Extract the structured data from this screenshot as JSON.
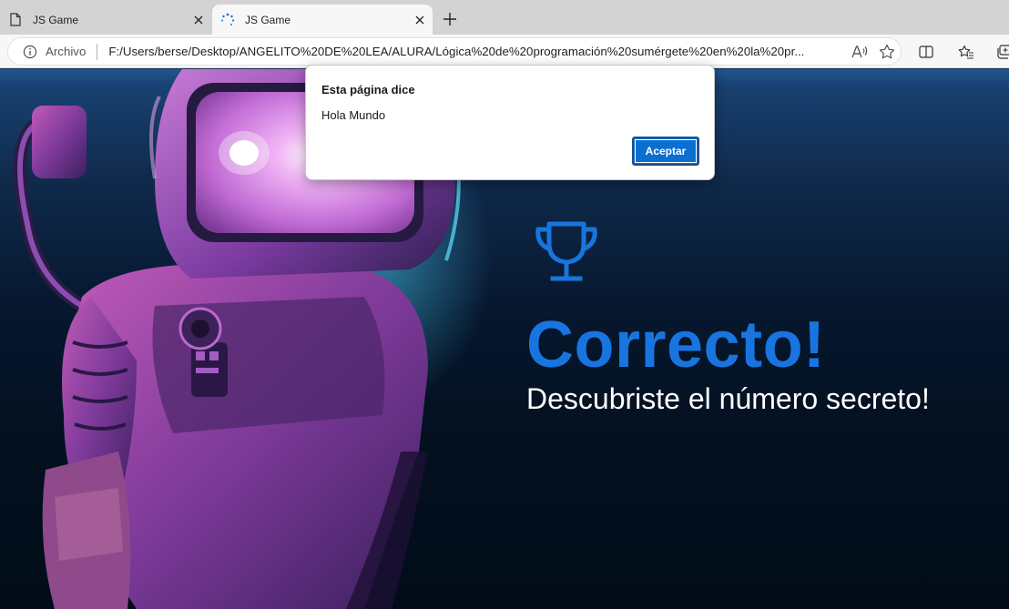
{
  "browser": {
    "tabs": [
      {
        "title": "JS Game",
        "icon": "page-icon",
        "active": false
      },
      {
        "title": "JS Game",
        "icon": "loading-spinner-icon",
        "active": true
      }
    ],
    "new_tab_icon": "plus-icon",
    "address_bar": {
      "scheme_label": "Archivo",
      "url": "F:/Users/berse/Desktop/ANGELITO%20DE%20LEA/ALURA/Lógica%20de%20programación%20sumérgete%20en%20la%20pr..."
    }
  },
  "page": {
    "heading": "Correcto!",
    "subheading": "Descubriste el número secreto!",
    "icon": "trophy-icon",
    "accent_color": "#1875e0"
  },
  "alert": {
    "title": "Esta página dice",
    "message": "Hola Mundo",
    "button_label": "Aceptar"
  }
}
